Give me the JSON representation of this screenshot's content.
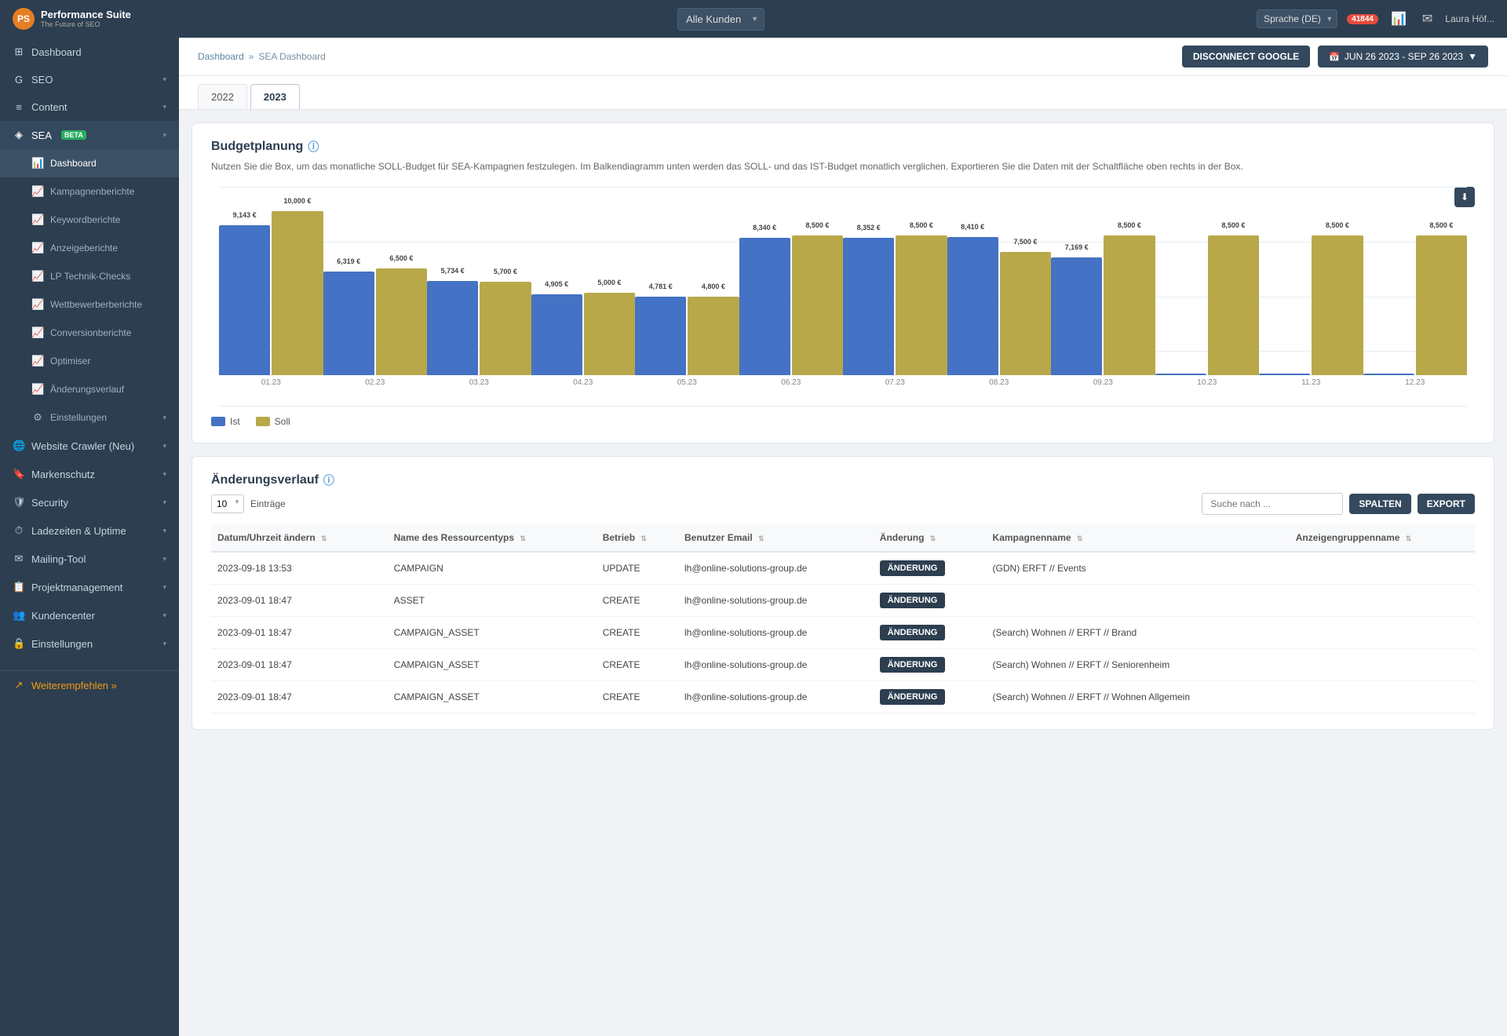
{
  "app": {
    "logo_initials": "PS",
    "title": "Performance Suite",
    "subtitle": "The Future of SEO"
  },
  "topnav": {
    "customer_label": "Alle Kunden",
    "lang_label": "Sprache (DE)",
    "badge_count": "41844",
    "user_name": "Laura Höf..."
  },
  "breadcrumb": {
    "parent": "Dashboard",
    "separator": "»",
    "current": "SEA Dashboard"
  },
  "header_buttons": {
    "disconnect": "DISCONNECT GOOGLE",
    "date_range": "JUN 26 2023 - SEP 26 2023"
  },
  "year_tabs": [
    "2022",
    "2023"
  ],
  "active_year": "2023",
  "budgetplanung": {
    "title": "Budgetplanung",
    "description": "Nutzen Sie die Box, um das monatliche SOLL-Budget für SEA-Kampagnen festzulegen. Im Balkendiagramm unten werden das SOLL- und das IST-Budget monatlich verglichen. Exportieren Sie die Daten mit der Schaltfläche oben rechts in der Box."
  },
  "chart": {
    "bars": [
      {
        "month": "01.23",
        "ist": 9143,
        "ist_label": "9,143 €",
        "soll": 10000,
        "soll_label": "10,000 €"
      },
      {
        "month": "02.23",
        "ist": 6319,
        "ist_label": "6,319 €",
        "soll": 6500,
        "soll_label": "6,500 €"
      },
      {
        "month": "03.23",
        "ist": 5734,
        "ist_label": "5,734 €",
        "soll": 5700,
        "soll_label": "5,700 €"
      },
      {
        "month": "04.23",
        "ist": 4905,
        "ist_label": "4,905 €",
        "soll": 5000,
        "soll_label": "5,000 €"
      },
      {
        "month": "05.23",
        "ist": 4781,
        "ist_label": "4,781 €",
        "soll": 4800,
        "soll_label": "4,800 €"
      },
      {
        "month": "06.23",
        "ist": 8340,
        "ist_label": "8,340 €",
        "soll": 8500,
        "soll_label": "8,500 €"
      },
      {
        "month": "07.23",
        "ist": 8352,
        "ist_label": "8,352 €",
        "soll": 8500,
        "soll_label": "8,500 €"
      },
      {
        "month": "08.23",
        "ist": 8410,
        "ist_label": "8,410 €",
        "soll": 7500,
        "soll_label": "7,500 €"
      },
      {
        "month": "09.23",
        "ist": 7169,
        "ist_label": "7,169 €",
        "soll": 8500,
        "soll_label": "8,500 €"
      },
      {
        "month": "10.23",
        "ist": 0,
        "ist_label": "0 €",
        "soll": 8500,
        "soll_label": "8,500 €"
      },
      {
        "month": "11.23",
        "ist": 0,
        "ist_label": "0 €",
        "soll": 8500,
        "soll_label": "8,500 €"
      },
      {
        "month": "12.23",
        "ist": 0,
        "ist_label": "0 €",
        "soll": 8500,
        "soll_label": "8,500 €"
      }
    ],
    "max_value": 10500,
    "legend": {
      "ist_label": "Ist",
      "soll_label": "Soll"
    }
  },
  "aenderungsverlauf": {
    "title": "Änderungsverlauf",
    "entries_label": "Einträge",
    "entries_value": "10",
    "search_placeholder": "Suche nach ...",
    "btn_spalten": "SPALTEN",
    "btn_export": "EXPORT",
    "columns": [
      "Datum/Uhrzeit ändern",
      "Name des Ressourcentyps",
      "Betrieb",
      "Benutzer Email",
      "Änderung",
      "Kampagnenname",
      "Anzeigengruppenname"
    ],
    "rows": [
      {
        "date": "2023-09-18 13:53",
        "type": "CAMPAIGN",
        "betrieb": "UPDATE",
        "email": "lh@online-solutions-group.de",
        "aenderung": "ÄNDERUNG",
        "kampagne": "(GDN) ERFT // Events",
        "anzeige": ""
      },
      {
        "date": "2023-09-01 18:47",
        "type": "ASSET",
        "betrieb": "CREATE",
        "email": "lh@online-solutions-group.de",
        "aenderung": "ÄNDERUNG",
        "kampagne": "",
        "anzeige": ""
      },
      {
        "date": "2023-09-01 18:47",
        "type": "CAMPAIGN_ASSET",
        "betrieb": "CREATE",
        "email": "lh@online-solutions-group.de",
        "aenderung": "ÄNDERUNG",
        "kampagne": "(Search) Wohnen // ERFT // Brand",
        "anzeige": ""
      },
      {
        "date": "2023-09-01 18:47",
        "type": "CAMPAIGN_ASSET",
        "betrieb": "CREATE",
        "email": "lh@online-solutions-group.de",
        "aenderung": "ÄNDERUNG",
        "kampagne": "(Search) Wohnen // ERFT // Seniorenheim",
        "anzeige": ""
      },
      {
        "date": "2023-09-01 18:47",
        "type": "CAMPAIGN_ASSET",
        "betrieb": "CREATE",
        "email": "lh@online-solutions-group.de",
        "aenderung": "ÄNDERUNG",
        "kampagne": "(Search) Wohnen // ERFT // Wohnen Allgemein",
        "anzeige": ""
      }
    ]
  },
  "sidebar": {
    "items": [
      {
        "label": "Dashboard",
        "icon": "⊞",
        "level": 0,
        "active": false,
        "id": "dashboard"
      },
      {
        "label": "SEO",
        "icon": "G",
        "level": 0,
        "active": false,
        "has_chevron": true,
        "id": "seo"
      },
      {
        "label": "Content",
        "icon": "≡",
        "level": 0,
        "active": false,
        "has_chevron": true,
        "id": "content"
      },
      {
        "label": "SEA",
        "icon": "◈",
        "level": 0,
        "active": true,
        "has_chevron": true,
        "badge": "BETA",
        "id": "sea"
      },
      {
        "label": "Dashboard",
        "icon": "📊",
        "level": 1,
        "active": true,
        "id": "sea-dashboard"
      },
      {
        "label": "Kampagnenberichte",
        "icon": "📈",
        "level": 1,
        "active": false,
        "id": "kampagnenberichte"
      },
      {
        "label": "Keywordberichte",
        "icon": "📈",
        "level": 1,
        "active": false,
        "id": "keywordberichte"
      },
      {
        "label": "Anzeigeberichte",
        "icon": "📈",
        "level": 1,
        "active": false,
        "id": "anzeigeberichte"
      },
      {
        "label": "LP Technik-Checks",
        "icon": "📈",
        "level": 1,
        "active": false,
        "id": "lp-checks"
      },
      {
        "label": "Wettbewerberberichte",
        "icon": "📈",
        "level": 1,
        "active": false,
        "id": "wettbewerber"
      },
      {
        "label": "Conversionberichte",
        "icon": "📈",
        "level": 1,
        "active": false,
        "id": "conversion"
      },
      {
        "label": "Optimiser",
        "icon": "📈",
        "level": 1,
        "active": false,
        "id": "optimiser"
      },
      {
        "label": "Änderungsverlauf",
        "icon": "📈",
        "level": 1,
        "active": false,
        "id": "aenderungsverlauf"
      },
      {
        "label": "Einstellungen",
        "icon": "⚙",
        "level": 1,
        "active": false,
        "has_chevron": true,
        "id": "einstellungen-sea"
      },
      {
        "label": "Website Crawler (Neu)",
        "icon": "🌐",
        "level": 0,
        "active": false,
        "has_chevron": true,
        "id": "website-crawler"
      },
      {
        "label": "Markenschutz",
        "icon": "🔖",
        "level": 0,
        "active": false,
        "has_chevron": true,
        "id": "markenschutz"
      },
      {
        "label": "Security",
        "icon": "🛡",
        "level": 0,
        "active": false,
        "has_chevron": true,
        "id": "security"
      },
      {
        "label": "Ladezeiten & Uptime",
        "icon": "⏱",
        "level": 0,
        "active": false,
        "has_chevron": true,
        "id": "ladezeiten"
      },
      {
        "label": "Mailing-Tool",
        "icon": "✉",
        "level": 0,
        "active": false,
        "has_chevron": true,
        "id": "mailing"
      },
      {
        "label": "Projektmanagement",
        "icon": "📋",
        "level": 0,
        "active": false,
        "has_chevron": true,
        "id": "projektmanagement"
      },
      {
        "label": "Kundencenter",
        "icon": "👥",
        "level": 0,
        "active": false,
        "has_chevron": true,
        "id": "kundencenter"
      },
      {
        "label": "Einstellungen",
        "icon": "🔒",
        "level": 0,
        "active": false,
        "has_chevron": true,
        "id": "einstellungen"
      }
    ],
    "bottom_items": [
      {
        "label": "Weiterempfehlen »",
        "icon": "↗",
        "id": "weiterempfehlen"
      }
    ]
  }
}
